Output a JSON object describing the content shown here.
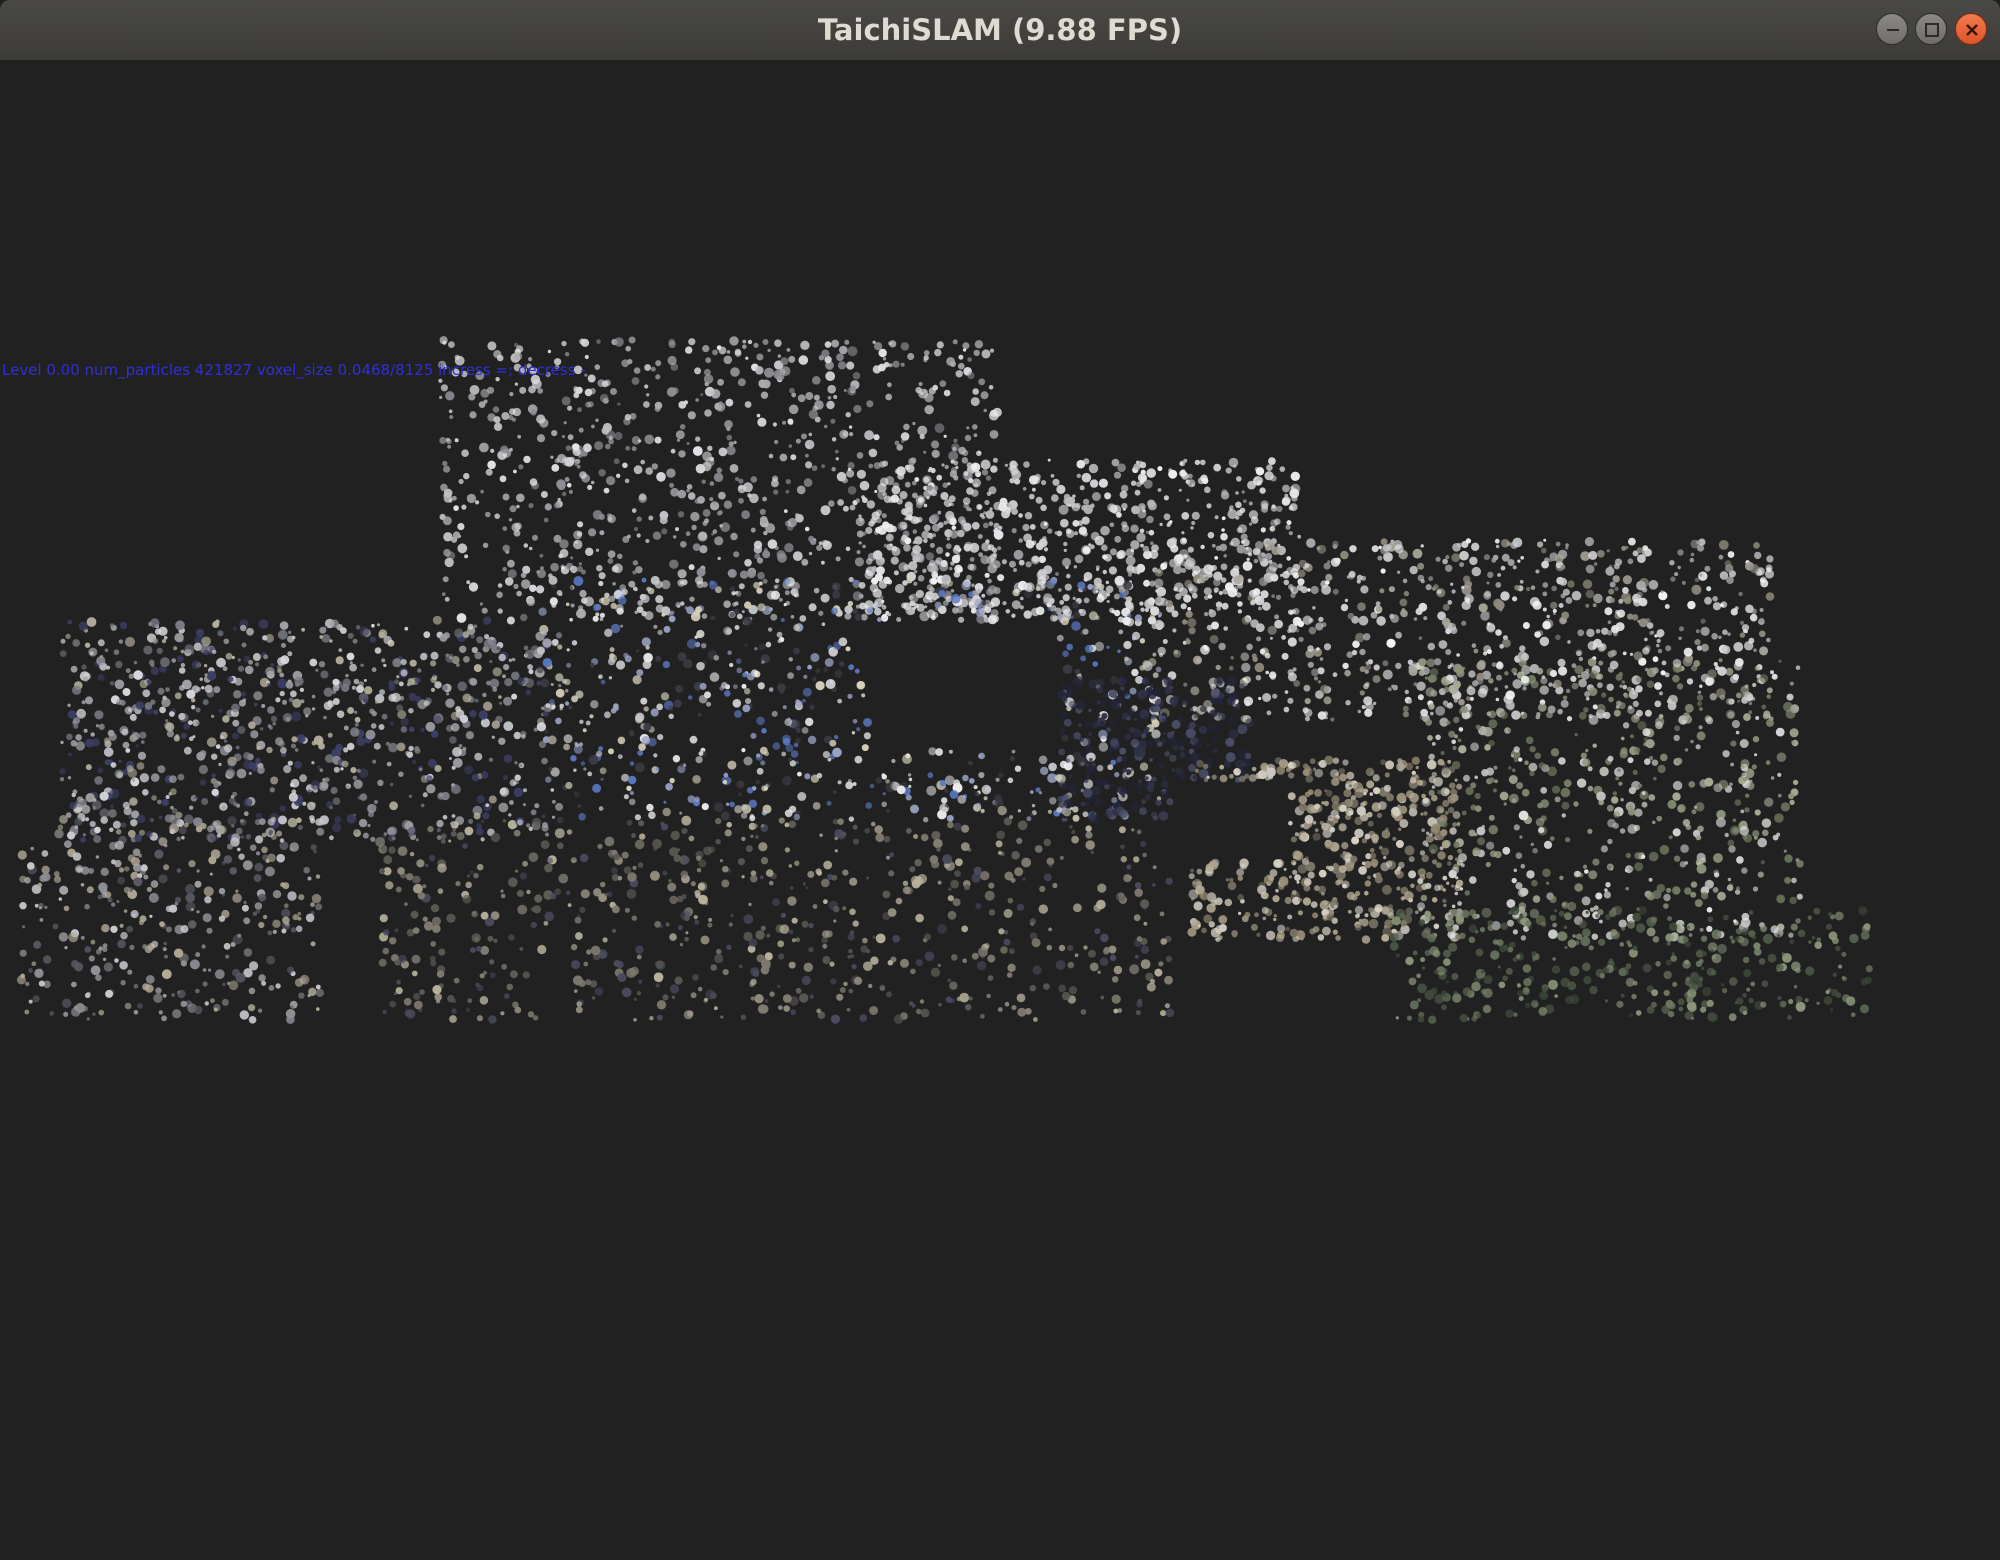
{
  "window": {
    "title": "TaichiSLAM (9.88 FPS)",
    "controls": {
      "minimize": "minimize-icon",
      "maximize": "maximize-icon",
      "close": "close-icon"
    }
  },
  "viewport": {
    "hud_text": "Level 0.00 num_particles 421827 voxel_size 0.0468/8125 incress =; decress -",
    "background_color": "#212121",
    "hud_color": "#2f2fd8"
  }
}
